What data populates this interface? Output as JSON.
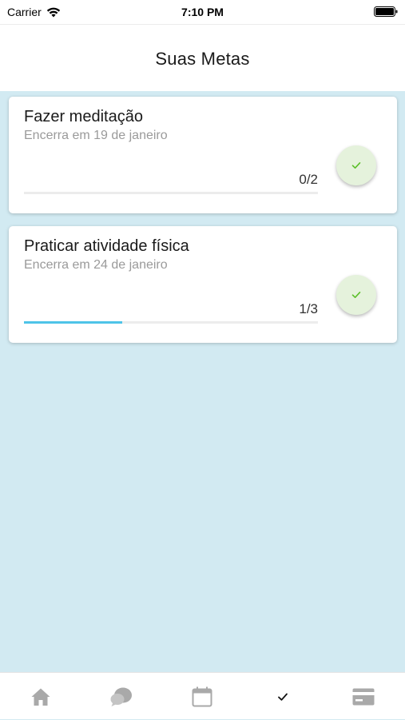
{
  "status_bar": {
    "carrier": "Carrier",
    "time": "7:10 PM",
    "icons": [
      "wifi-icon",
      "battery-icon"
    ]
  },
  "header": {
    "title": "Suas Metas"
  },
  "goals": [
    {
      "title": "Fazer meditação",
      "subtitle": "Encerra em 19 de janeiro",
      "progress_text": "0/2",
      "progress": 0.0,
      "action_icon": "check-icon"
    },
    {
      "title": "Praticar atividade física",
      "subtitle": "Encerra em 24 de janeiro",
      "progress_text": "1/3",
      "progress": 0.333,
      "action_icon": "check-icon"
    }
  ],
  "tab_bar": {
    "tabs": [
      {
        "icon": "home-icon",
        "active": false
      },
      {
        "icon": "chat-icon",
        "active": false
      },
      {
        "icon": "calendar-icon",
        "active": false
      },
      {
        "icon": "check-icon",
        "active": true
      },
      {
        "icon": "card-icon",
        "active": false
      }
    ]
  },
  "colors": {
    "background": "#d2eaf2",
    "progress_fill": "#4ec4e8",
    "check_button_bg": "#e5f2dc",
    "check_green": "#5cbf2a",
    "tab_inactive": "#a9a9a9"
  }
}
